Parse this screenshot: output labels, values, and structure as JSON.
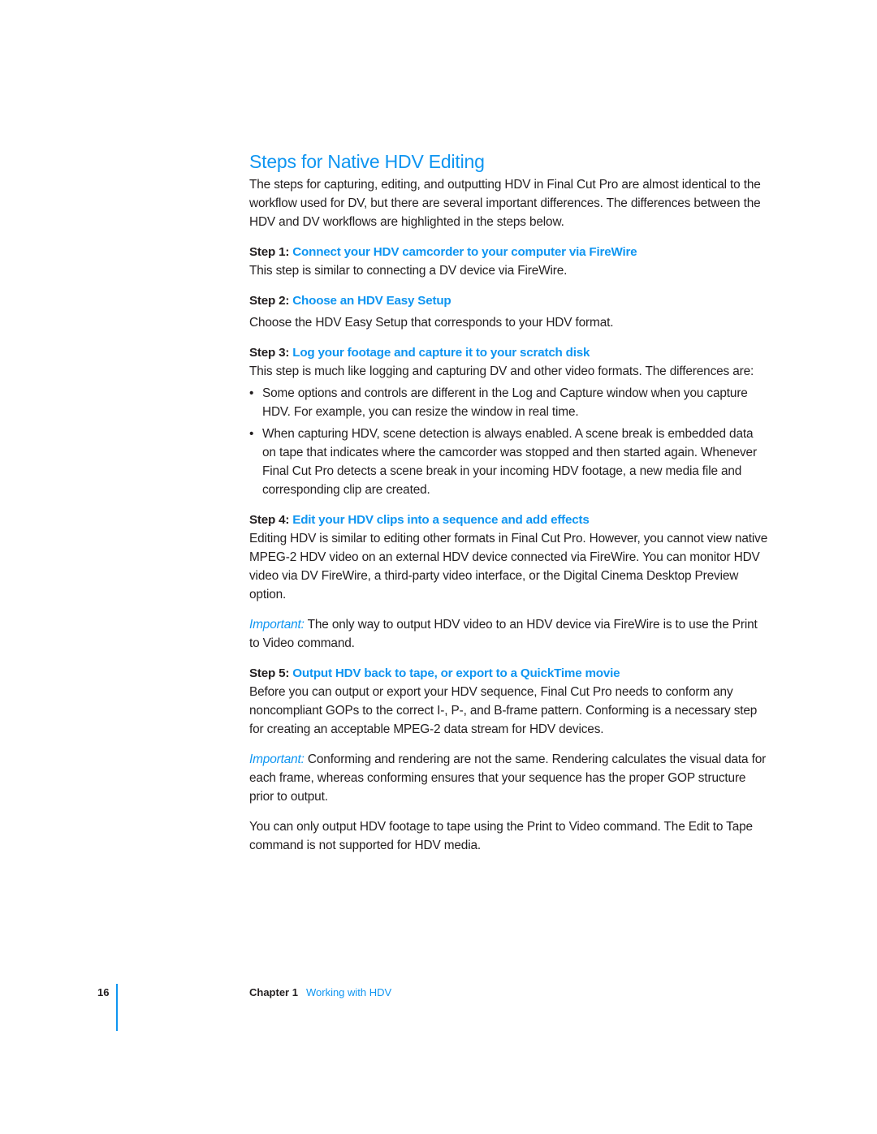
{
  "section_title": "Steps for Native HDV Editing",
  "intro": "The steps for capturing, editing, and outputting HDV in Final Cut Pro are almost identical to the workflow used for DV, but there are several important differences. The differences between the HDV and DV workflows are highlighted in the steps below.",
  "steps": [
    {
      "number": "Step 1:",
      "title": "Connect your HDV camcorder to your computer via FireWire",
      "body": "This step is similar to connecting a DV device via FireWire."
    },
    {
      "number": "Step 2:",
      "title": "Choose an HDV Easy Setup",
      "body": "Choose the HDV Easy Setup that corresponds to your HDV format."
    },
    {
      "number": "Step 3:",
      "title": "Log your footage and capture it to your scratch disk",
      "body": "This step is much like logging and capturing DV and other video formats. The differences are:",
      "bullets": [
        "Some options and controls are different in the Log and Capture window when you capture HDV. For example, you can resize the window in real time.",
        "When capturing HDV, scene detection is always enabled. A scene break is embedded data on tape that indicates where the camcorder was stopped and then started again. Whenever Final Cut Pro detects a scene break in your incoming HDV footage, a new media file and corresponding clip are created."
      ]
    },
    {
      "number": "Step 4:",
      "title": "Edit your HDV clips into a sequence and add effects",
      "body": "Editing HDV is similar to editing other formats in Final Cut Pro. However, you cannot view native MPEG-2 HDV video on an external HDV device connected via FireWire. You can monitor HDV video via DV FireWire, a third-party video interface, or the Digital Cinema Desktop Preview option.",
      "important_label": "Important:",
      "important_text": " The only way to output HDV video to an HDV device via FireWire is to use the Print to Video command."
    },
    {
      "number": "Step 5:",
      "title": "Output HDV back to tape, or export to a QuickTime movie",
      "body": "Before you can output or export your HDV sequence, Final Cut Pro needs to conform any noncompliant GOPs to the correct I-, P-, and B-frame pattern. Conforming is a necessary step for creating an acceptable MPEG-2 data stream for HDV devices.",
      "important_label": "Important:",
      "important_text": " Conforming and rendering are not the same. Rendering calculates the visual data for each frame, whereas conforming ensures that your sequence has the proper GOP structure prior to output.",
      "closing": "You can only output HDV footage to tape using the Print to Video command. The Edit to Tape command is not supported for HDV media."
    }
  ],
  "bullet_glyph": "•",
  "footer": {
    "page_number": "16",
    "chapter_label": "Chapter 1",
    "chapter_title": "Working with HDV"
  },
  "colors": {
    "accent": "#0e95f1",
    "text": "#231f20"
  }
}
